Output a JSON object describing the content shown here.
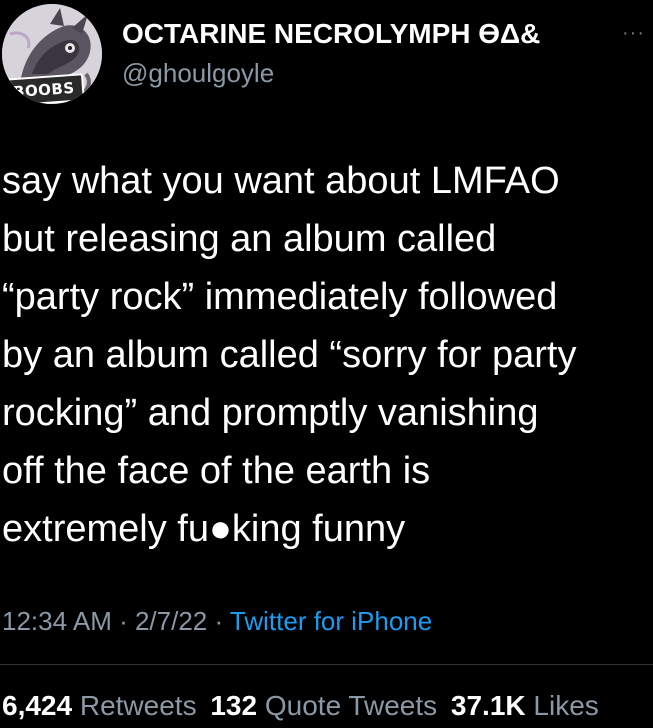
{
  "tweet": {
    "author": {
      "display_name": "OCTARINE NECROLYMPH ϴΔ&",
      "handle": "@ghoulgoyle",
      "avatar_badge": "BOOBS",
      "avatar_icon": "avatar-illustration"
    },
    "more_icon": "···",
    "text_lines": [
      "say what you want about LMFAO",
      "but releasing an album called",
      "“party rock” immediately followed",
      "by an album called “sorry for party",
      "rocking” and promptly vanishing",
      "off the face of the earth is",
      "extremely fu●king funny"
    ],
    "time": "12:34 AM",
    "date": "2/7/22",
    "separator": " · ",
    "source": "Twitter for iPhone",
    "stats": {
      "retweets_count": "6,424",
      "retweets_label": "Retweets",
      "quotes_count": "132",
      "quotes_label": "Quote Tweets",
      "likes_count": "37.1K",
      "likes_label": "Likes"
    }
  },
  "colors": {
    "background": "#000000",
    "text": "#ffffff",
    "secondary": "#8b98a5",
    "link": "#1d9bf0"
  }
}
